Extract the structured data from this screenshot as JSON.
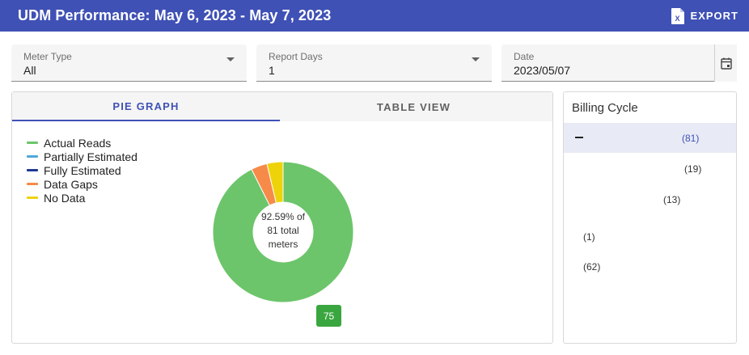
{
  "header": {
    "title": "UDM Performance: May 6, 2023 - May 7, 2023",
    "export_label": "EXPORT",
    "export_icon": "excel-file-icon"
  },
  "filters": {
    "meter_type": {
      "label": "Meter Type",
      "value": "All"
    },
    "report_days": {
      "label": "Report Days",
      "value": "1"
    },
    "date": {
      "label": "Date",
      "value": "2023/05/07",
      "icon": "calendar-icon"
    }
  },
  "tabs": [
    {
      "label": "PIE GRAPH",
      "active": true
    },
    {
      "label": "TABLE VIEW",
      "active": false
    }
  ],
  "chart_data": {
    "type": "pie",
    "categories": [
      "Actual Reads",
      "Partially Estimated",
      "Fully Estimated",
      "Data Gaps",
      "No Data"
    ],
    "values": [
      75,
      0,
      0,
      3,
      3
    ],
    "colors": [
      "#6cc56a",
      "#4ea8dc",
      "#1f3a93",
      "#f68a48",
      "#eed30a"
    ],
    "legend_position": "top-left",
    "center_label": [
      "92.59% of",
      "81 total",
      "meters"
    ],
    "data_labels": [
      {
        "category": "Actual Reads",
        "text": "75"
      }
    ]
  },
  "billing_cycle": {
    "title": "Billing Cycle",
    "rows": [
      {
        "count": "(81)",
        "selected": true,
        "collapse_icon": true
      },
      {
        "count": "(19)",
        "selected": false
      },
      {
        "count": "(13)",
        "selected": false
      },
      {
        "count": "(1)",
        "selected": false
      },
      {
        "count": "(62)",
        "selected": false
      }
    ]
  }
}
